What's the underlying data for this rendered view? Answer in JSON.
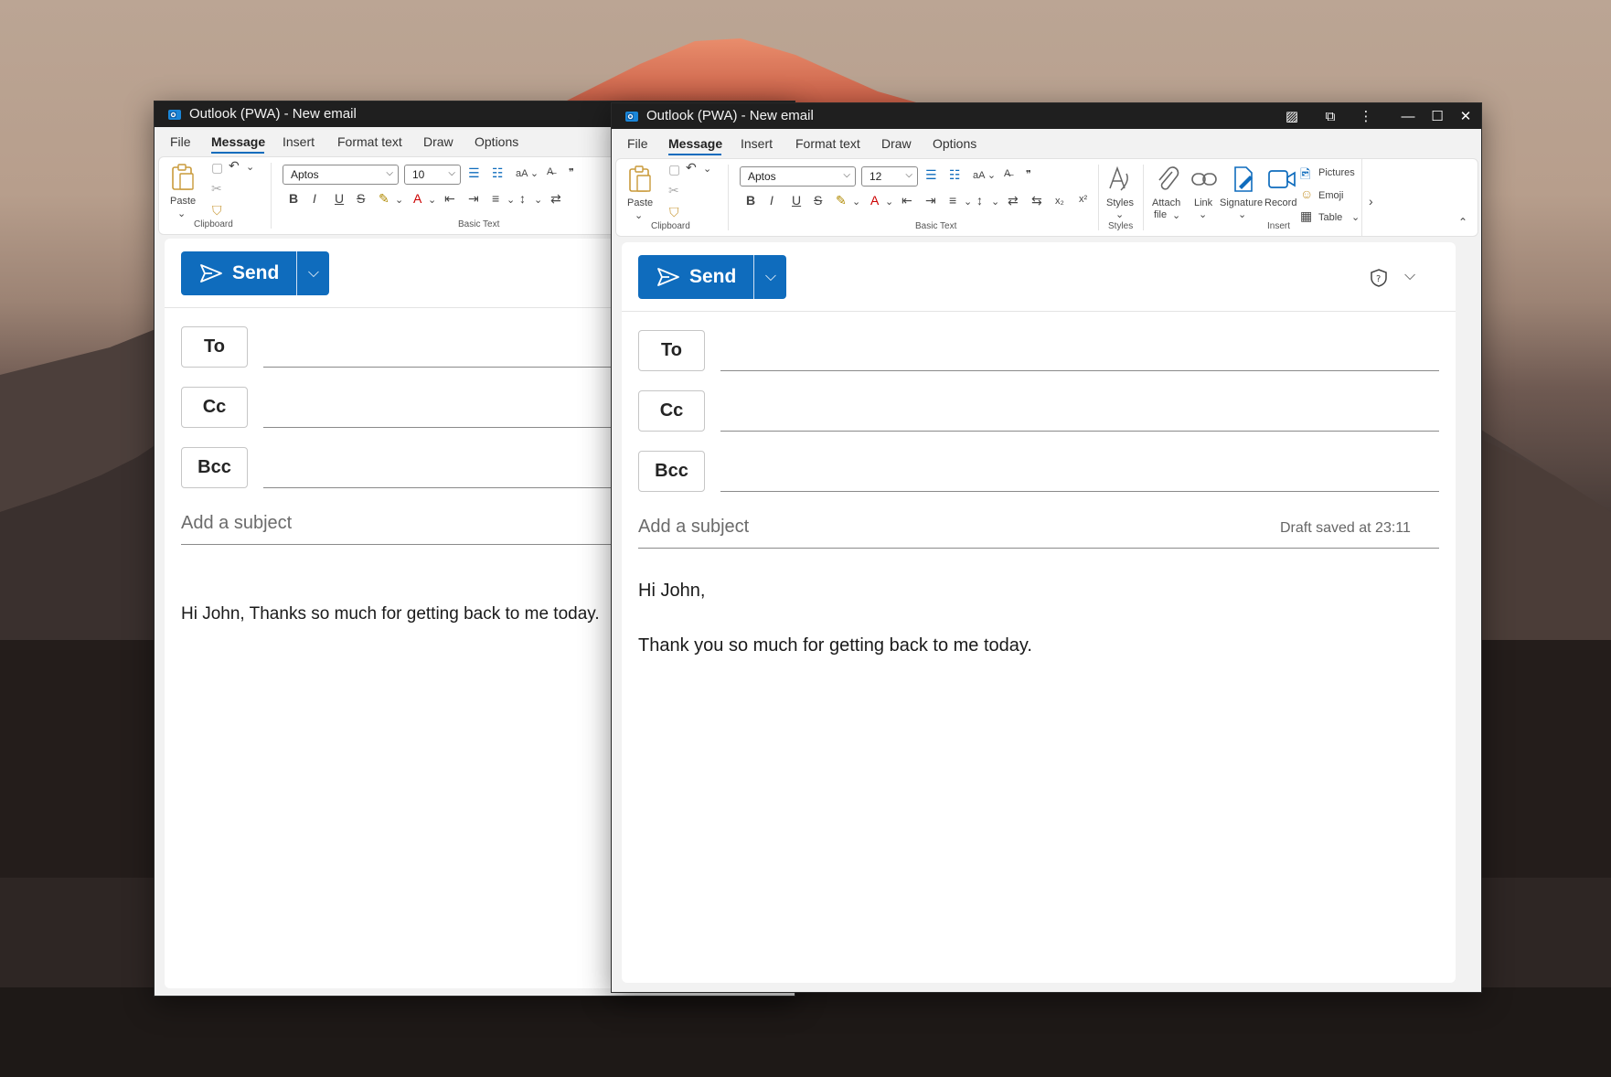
{
  "left_window": {
    "title": "Outlook (PWA) - New email",
    "menu": [
      "File",
      "Message",
      "Insert",
      "Format text",
      "Draw",
      "Options"
    ],
    "ribbon": {
      "paste_label": "Paste",
      "clipboard_group": "Clipboard",
      "font_name": "Aptos",
      "font_size": "10",
      "basic_text_group": "Basic Text"
    },
    "send_label": "Send",
    "to_label": "To",
    "cc_label": "Cc",
    "bcc_label": "Bcc",
    "subject_placeholder": "Add a subject",
    "body_line": "Hi John, Thanks so much for getting back to me today."
  },
  "right_window": {
    "title": "Outlook (PWA) - New email",
    "menu": [
      "File",
      "Message",
      "Insert",
      "Format text",
      "Draw",
      "Options"
    ],
    "ribbon": {
      "paste_label": "Paste",
      "clipboard_group": "Clipboard",
      "font_name": "Aptos",
      "font_size": "12",
      "basic_text_group": "Basic Text",
      "styles_label": "Styles",
      "styles_group": "Styles",
      "attach_label": "Attach",
      "attach_label2": "file",
      "link_label": "Link",
      "signature_label": "Signature",
      "record_label": "Record",
      "pictures_label": "Pictures",
      "emoji_label": "Emoji",
      "table_label": "Table",
      "insert_group": "Insert"
    },
    "send_label": "Send",
    "to_label": "To",
    "cc_label": "Cc",
    "bcc_label": "Bcc",
    "subject_placeholder": "Add a subject",
    "draft_status": "Draft saved at 23:11",
    "body_line1": "Hi John,",
    "body_line2": "Thank you so much for getting back to me today."
  },
  "colors": {
    "accent": "#0f6cbd",
    "titlebar": "#1f1f1f"
  }
}
